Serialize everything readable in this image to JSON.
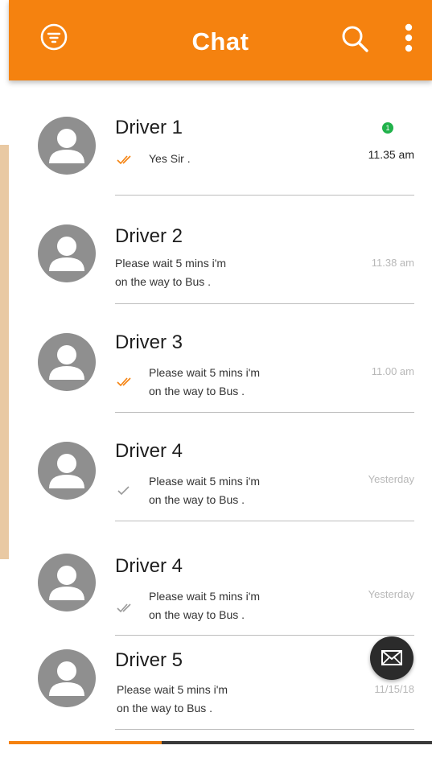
{
  "header": {
    "title": "Chat",
    "menu_icon": "filter-circle-icon",
    "search_icon": "search-icon",
    "more_icon": "more-vertical-icon",
    "color": "#f5820f"
  },
  "chats": [
    {
      "name": "Driver 1",
      "message_lines": [
        "Yes Sir ."
      ],
      "time": "11.35 am",
      "status": "read-double-check",
      "unread_count": "1"
    },
    {
      "name": "Driver 2",
      "message_lines": [
        "Please wait 5 mins i'm",
        "on the way to Bus ."
      ],
      "time": "11.38 am",
      "status": "none"
    },
    {
      "name": "Driver 3",
      "message_lines": [
        "Please wait 5 mins i'm",
        "on the way to Bus ."
      ],
      "time": "11.00 am",
      "status": "read-double-check"
    },
    {
      "name": "Driver 4",
      "message_lines": [
        "Please wait 5 mins i'm",
        "on the way to Bus ."
      ],
      "time": "Yesterday",
      "status": "sent-single-check"
    },
    {
      "name": "Driver 4",
      "message_lines": [
        "Please wait 5 mins i'm",
        "on the way to Bus ."
      ],
      "time": "Yesterday",
      "status": "delivered-double-check"
    },
    {
      "name": "Driver 5",
      "message_lines": [
        "Please wait 5 mins i'm",
        "on the way to Bus ."
      ],
      "time": "11/15/18",
      "status": "none"
    }
  ],
  "fab": {
    "icon": "mail-icon"
  },
  "colors": {
    "accent": "#f5820f",
    "online": "#21b24b",
    "avatar": "#8f8f8f"
  }
}
